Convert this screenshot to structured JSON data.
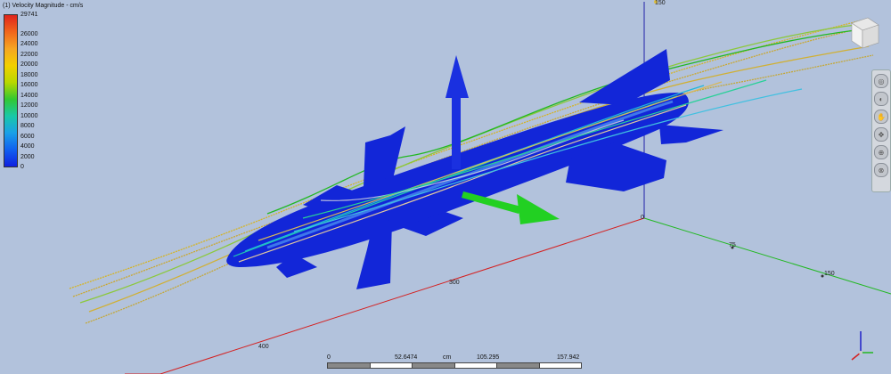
{
  "legend": {
    "title": "(1) Velocity Magnitude - cm/s",
    "max_label": "29741",
    "ticks": [
      "26000",
      "24000",
      "22000",
      "20000",
      "18000",
      "16000",
      "14000",
      "12000",
      "10000",
      "8000",
      "6000",
      "4000",
      "2000",
      "0"
    ],
    "gradient": [
      "#e0241c",
      "#f0661c",
      "#f5a623",
      "#f2d000",
      "#b8d800",
      "#32c832",
      "#18c8a8",
      "#1aa0e8",
      "#1060f0",
      "#1020e0"
    ]
  },
  "axes": {
    "z_top_label": "150",
    "origin_label": "0",
    "x_labels": [
      "75",
      "150"
    ],
    "y_labels": [
      "300",
      "400"
    ]
  },
  "scalebar": {
    "labels": [
      "0",
      "52.6474",
      "105.295",
      "157.942"
    ],
    "unit": "cm"
  },
  "navbar": {
    "buttons": [
      "orbit",
      "look",
      "pan",
      "walk",
      "zoom",
      "fit"
    ]
  },
  "colors": {
    "background": "#b2c2dc",
    "model": "#1226d8",
    "lift_arrow": "#1a30e0",
    "flow_arrow": "#22d022",
    "axis_x": "#22b822",
    "axis_y": "#d42020",
    "axis_z": "#2020a8"
  }
}
